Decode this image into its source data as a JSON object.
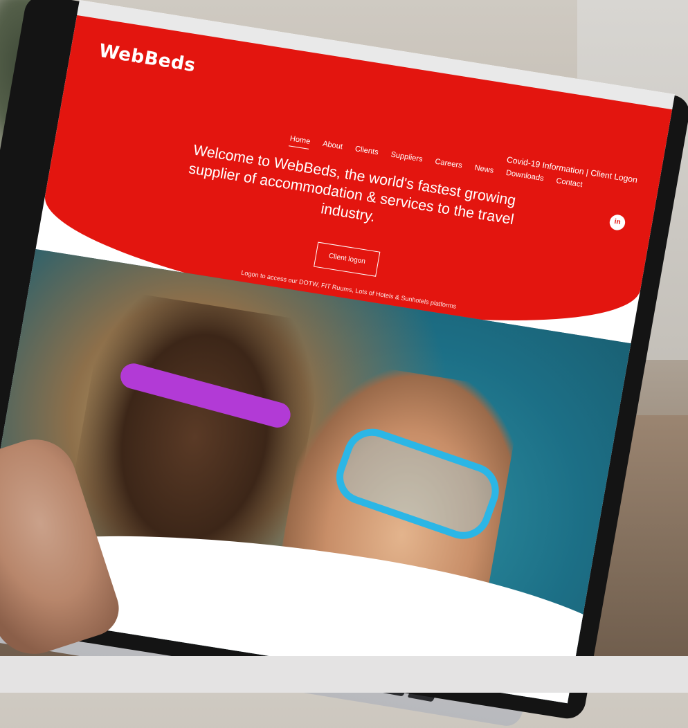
{
  "site": {
    "logo": "WebBeds",
    "nav": [
      "Home",
      "About",
      "Clients",
      "Suppliers",
      "Careers",
      "News",
      "Downloads",
      "Contact"
    ],
    "utility_links": [
      "Covid-19 Information",
      "Client Logon"
    ],
    "social": "in",
    "headline": "Welcome to WebBeds, the world's fastest growing supplier of accommodation & services to the travel industry.",
    "cta": "Client logon",
    "subtext": "Logon to access our DOTW, FIT Ruums, Lots of Hotels & Sunhotels platforms"
  },
  "colors": {
    "brand_red": "#e3150f"
  }
}
